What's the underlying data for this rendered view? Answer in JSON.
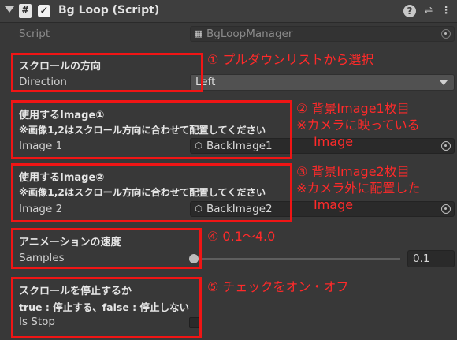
{
  "header": {
    "title": "Bg Loop (Script)",
    "script_icon_glyph": "#",
    "enabled_check": "✓",
    "help_icon": "?",
    "preset_icon": "⇌",
    "menu_icon": "⋮"
  },
  "script_row": {
    "label": "Script",
    "value": "BgLoopManager"
  },
  "direction": {
    "header": "スクロールの方向",
    "label": "Direction",
    "value": "Left"
  },
  "image1": {
    "header": "使用するImage①",
    "note": "※画像1,2はスクロール方向に合わせて配置してください",
    "label": "Image 1",
    "value": "BackImage1"
  },
  "image2": {
    "header": "使用するImage②",
    "note": "※画像1,2はスクロール方向に合わせて配置してください",
    "label": "Image 2",
    "value": "BackImage2"
  },
  "samples": {
    "header": "アニメーションの速度",
    "label": "Samples",
    "value": "0.1",
    "slider_fraction": 0.0
  },
  "is_stop": {
    "header": "スクロールを停止するか",
    "note": "true : 停止する、false : 停止しない",
    "label": "Is Stop",
    "checked": false
  },
  "annotations": {
    "a1": "① プルダウンリストから選択",
    "a2_line1": "② 背景Image1枚目",
    "a2_line2": "※カメラに映っている",
    "a2_line3": "Image",
    "a3_line1": "③ 背景Image2枚目",
    "a3_line2": "※カメラ外に配置した",
    "a3_line3": "Image",
    "a4": "④ 0.1～4.0",
    "a5": "⑤ チェックをオン・オフ"
  },
  "colors": {
    "annotation": "#f01515",
    "background": "#383838"
  }
}
